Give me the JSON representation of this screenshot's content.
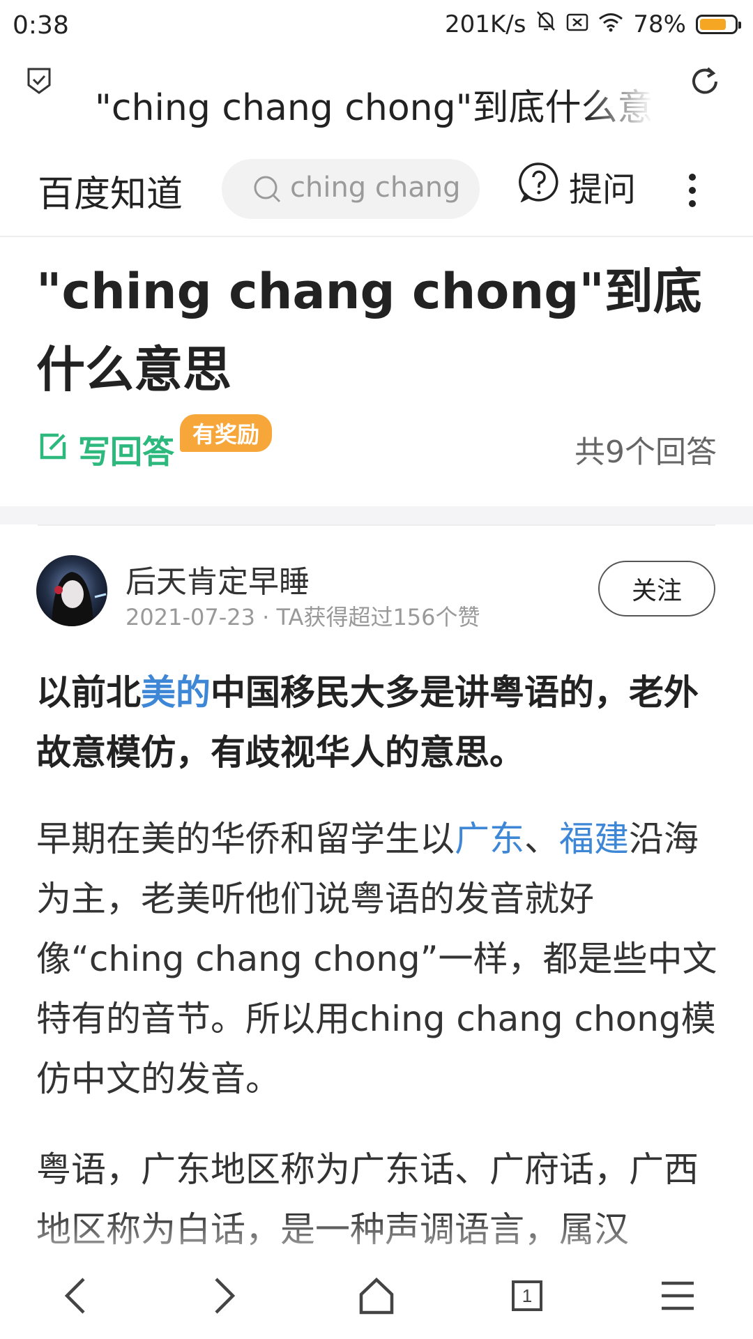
{
  "status_bar": {
    "time": "0:38",
    "speed": "201K/s",
    "battery_text": "78%",
    "battery_level": 0.78,
    "battery_color": "#f5a623"
  },
  "url_bar": {
    "title": "\"ching chang chong\"到底什么意思",
    "shield_icon": "shield-check-icon",
    "refresh_icon": "refresh-icon"
  },
  "site_header": {
    "logo": "百度知道",
    "search_placeholder": "ching chang",
    "ask_label": "提问"
  },
  "question": {
    "title": "\"ching chang chong\"到底什么意思",
    "write_answer": "写回答",
    "reward_badge": "有奖励",
    "answer_count": "共9个回答",
    "accent_color": "#2db87d"
  },
  "answer": {
    "author": "后天肯定早睡",
    "meta": "2021-07-23 · TA获得超过156个赞",
    "follow_label": "关注",
    "lead": {
      "part1": "以前北",
      "link1": "美的",
      "part2": "中国移民大多是讲粤语的，老外故意模仿，有歧视华人的意思。"
    },
    "p2": {
      "part1": "早期在美的华侨和留学生以",
      "link1": "广东",
      "sep": "、",
      "link2": "福建",
      "part2": "沿海为主，老美听他们说粤语的发音就好像“ching chang chong”一样，都是些中文特有的音节。所以用ching chang chong模仿中文的发音。"
    },
    "p3": "粤语，广东地区称为广东话、广府话，广西地区称为白话，是一种声调语言，属汉",
    "link_color": "#3e87d6"
  },
  "bottom_nav": {
    "tab_count": "1",
    "icons": [
      "back-icon",
      "forward-icon",
      "home-icon",
      "tabs-icon",
      "menu-icon"
    ]
  }
}
